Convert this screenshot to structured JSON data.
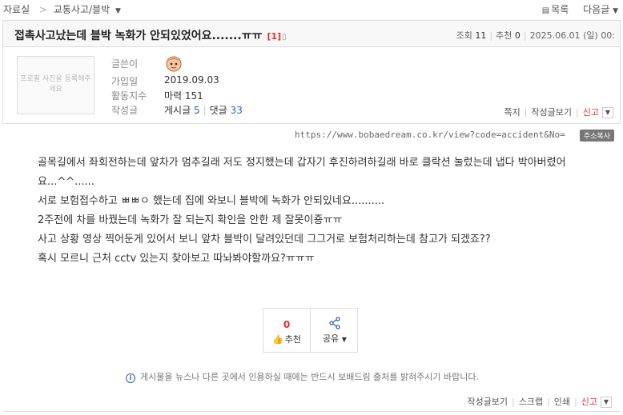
{
  "breadcrumb": {
    "root": "자료실",
    "separator": ">",
    "board": "교통사고/블박"
  },
  "top_nav": {
    "list_label": "목록",
    "next_label": "다음글"
  },
  "post": {
    "title": "접촉사고났는데 블박 녹화가 안되있었어요.......ㅠㅠ",
    "comment_count": "[1]",
    "views_label": "조회",
    "views": "11",
    "recommend_label": "추천",
    "recommend": "0",
    "date": "2025.06.01 (일) 00:"
  },
  "profile": {
    "photo_placeholder": "프로필 사진을 등록해주세요",
    "labels": {
      "author": "글쓴이",
      "joined": "가입일",
      "activity": "활동지수",
      "posts": "작성글"
    },
    "joined": "2019.09.03",
    "activity": "마력 151",
    "posts_label": "게시글",
    "posts_count": "5",
    "comments_label": "댓글",
    "comments_count": "33",
    "actions": {
      "note": "쪽지",
      "view_posts": "작성글보기",
      "report": "신고"
    }
  },
  "url": {
    "text": "https://www.bobaedream.co.kr/view?code=accident&No=",
    "copy_label": "주소복사"
  },
  "content": [
    "골목길에서 좌회전하는데 앞차가 멈추길래 저도 정지했는데 갑자기 후진하려하길래 바로 클락션 눌렀는데 냅다 박아버렸어요...^^......",
    "서로 보험접수하고 ㅃㅃㅇ 했는데 집에 와보니 블박에 녹화가 안되있네요..........",
    "2주전에 차를 바꿨는데 녹화가 잘 되는지 확인을 안한 제 잘못이죵ㅠㅠ",
    "사고 상황 영상 찍어둔게 있어서 보니 앞차 블박이 달려있던데 그그거로 보험처리하는데 참고가 되겠죠??",
    "혹시 모르니 근처 cctv 있는지 찾아보고 따놔봐야할까요?ㅠㅠㅠ"
  ],
  "actions": {
    "recommend_count": "0",
    "recommend_label": "추천",
    "share_label": "공유"
  },
  "notice": "게시물을 뉴스나 다른 곳에서 인용하실 때에는 반드시 보배드림 출처를 밝혀주시기 바랍니다.",
  "bottom_links": {
    "view_posts": "작성글보기",
    "scrap": "스크랩",
    "print": "인쇄",
    "report": "신고"
  }
}
